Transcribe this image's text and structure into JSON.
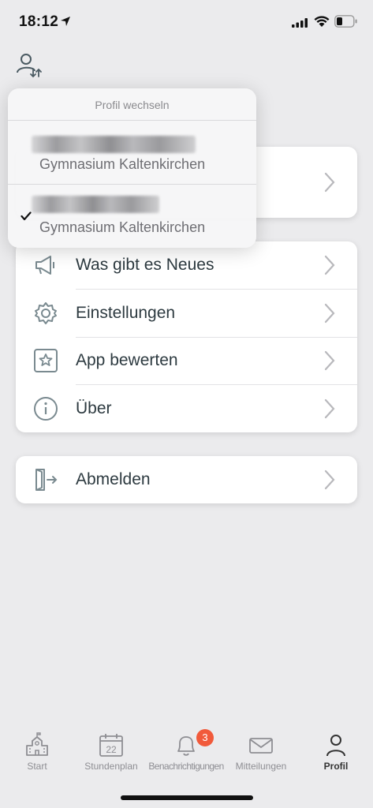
{
  "status_bar": {
    "time": "18:12"
  },
  "popover": {
    "title": "Profil wechseln",
    "profiles": [
      {
        "school": "Gymnasium Kaltenkirchen",
        "selected": false
      },
      {
        "school": "Gymnasium Kaltenkirchen",
        "selected": true
      }
    ]
  },
  "menu": {
    "items": [
      {
        "label": "Was gibt es Neues",
        "icon": "megaphone-icon"
      },
      {
        "label": "Einstellungen",
        "icon": "gear-icon"
      },
      {
        "label": "App bewerten",
        "icon": "star-icon"
      },
      {
        "label": "Über",
        "icon": "info-icon"
      }
    ],
    "logout_label": "Abmelden"
  },
  "tabs": [
    {
      "label": "Start",
      "icon": "school-icon"
    },
    {
      "label": "Stundenplan",
      "icon": "calendar-icon",
      "calendar_day": "22"
    },
    {
      "label": "Benachrichtigungen",
      "icon": "bell-icon",
      "badge": "3"
    },
    {
      "label": "Mitteilungen",
      "icon": "mail-icon"
    },
    {
      "label": "Profil",
      "icon": "person-icon",
      "active": true
    }
  ],
  "colors": {
    "badge": "#f15a3b",
    "text": "#2d3a40",
    "icon": "#8e8e93"
  }
}
